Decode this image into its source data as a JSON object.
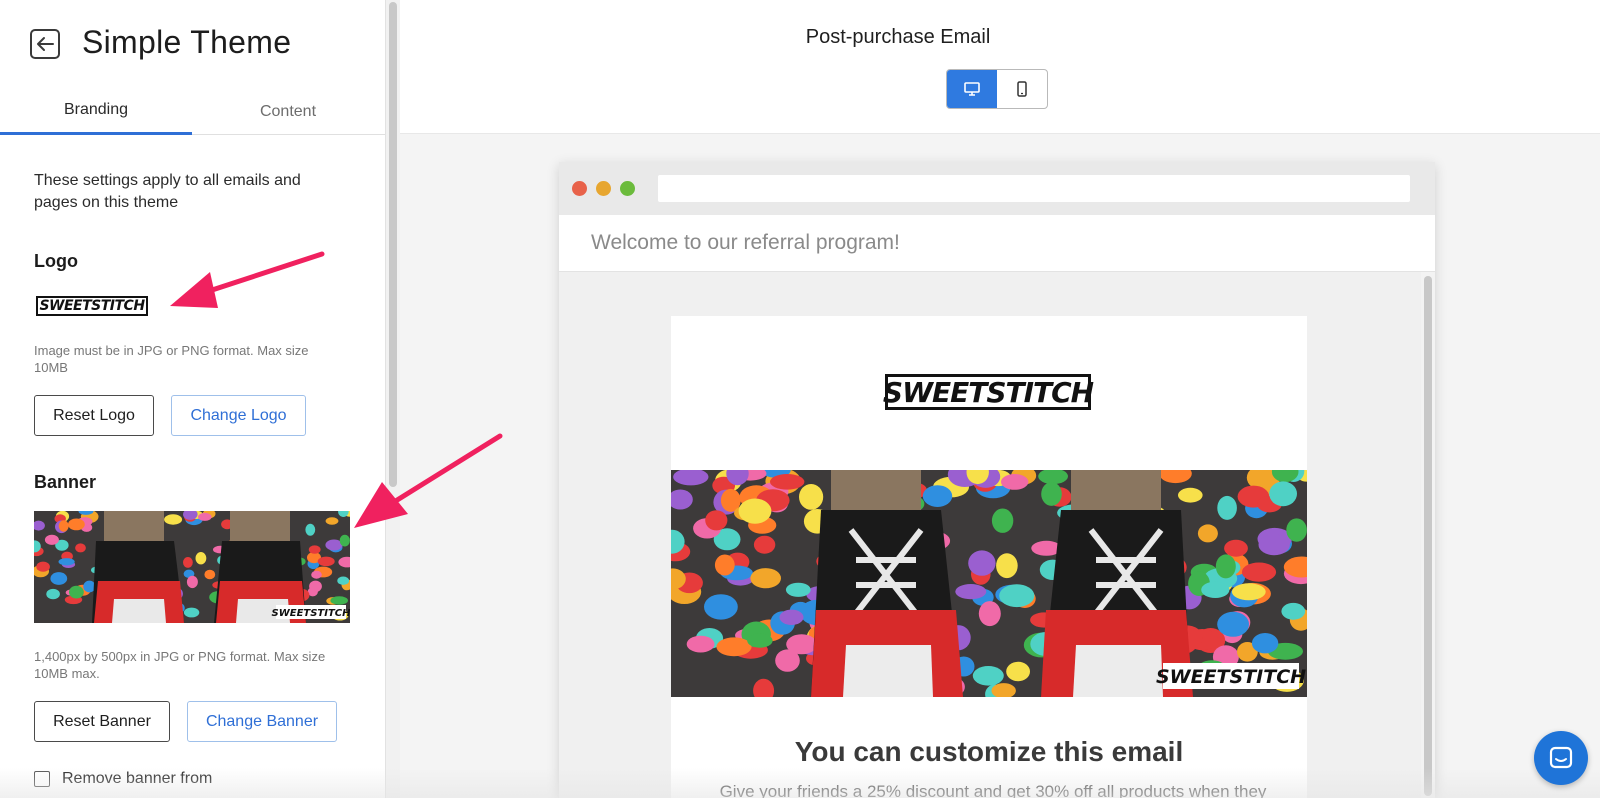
{
  "sidebar": {
    "title": "Simple Theme",
    "tabs": [
      {
        "label": "Branding",
        "active": true
      },
      {
        "label": "Content",
        "active": false
      }
    ],
    "help_text": "These settings apply to all emails and pages on this theme",
    "logo_section": {
      "title": "Logo",
      "logo_text": "SWEETSTITCH",
      "note": "Image must be in JPG or PNG format. Max size 10MB",
      "reset_label": "Reset Logo",
      "change_label": "Change Logo"
    },
    "banner_section": {
      "title": "Banner",
      "note": "1,400px by 500px in JPG or PNG format. Max size 10MB max.",
      "reset_label": "Reset Banner",
      "change_label": "Change Banner",
      "remove_banner_label": "Remove banner from"
    }
  },
  "main": {
    "email_title": "Post-purchase Email",
    "view_modes": [
      {
        "icon": "desktop-icon",
        "active": true
      },
      {
        "icon": "mobile-icon",
        "active": false
      }
    ],
    "preview": {
      "subject": "Welcome to our referral program!",
      "logo_text": "SWEETSTITCH",
      "headline": "You can customize this email",
      "body_text": "Give your friends a 25% discount and get 30% off all products when they"
    }
  },
  "colors": {
    "accent": "#2f6fd6",
    "annotation_arrow": "#f0215f",
    "chat_button": "#1f74d8"
  }
}
